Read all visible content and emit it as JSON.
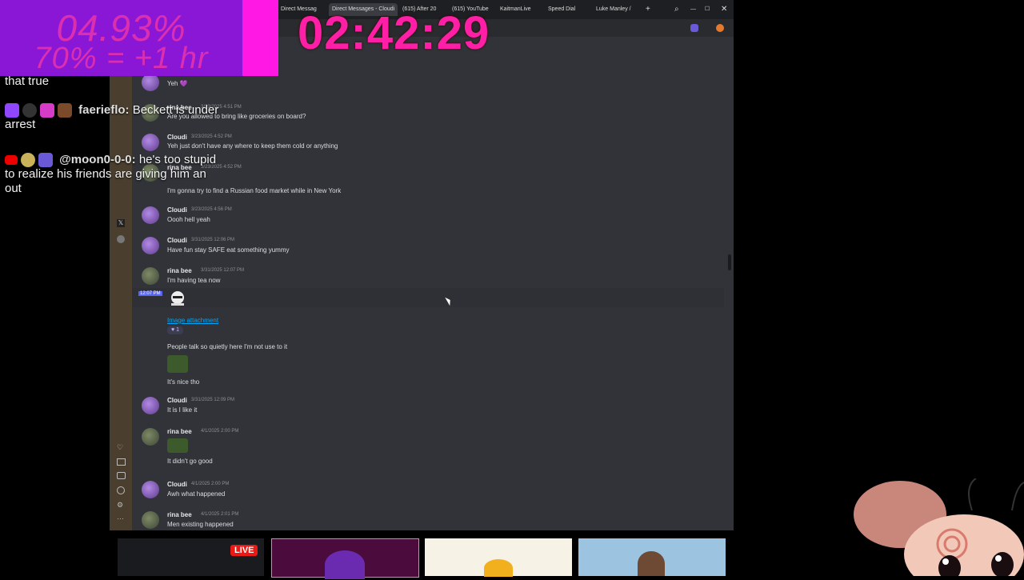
{
  "overlay": {
    "timer_percent": "04.93%",
    "timer_rule": "70% = +1 hr",
    "clock": "02:42:29",
    "live_label": "LIVE"
  },
  "chat": [
    {
      "user": "",
      "text": "that true"
    },
    {
      "user": "faerieflo:",
      "text": "Beckett is under arrest"
    },
    {
      "user": "@moon0-0-0:",
      "text": "he's too stupid to realize his friends are giving him an out"
    }
  ],
  "browser": {
    "tabs": [
      "Direct Messag",
      "Direct Messages - Cloudi",
      "(615) After 20",
      "(615) YouTube",
      "KaitmanLive",
      "Speed Dial",
      "Luke Manley /"
    ]
  },
  "messages": [
    {
      "author": "",
      "time": "",
      "lines": [
        "Yeh 💜"
      ],
      "avatar": "cloudi"
    },
    {
      "author": "rina bee",
      "time": "3/23/2025 4:51 PM",
      "lines": [
        "Are you allowed to bring like groceries on board?"
      ],
      "avatar": "rina"
    },
    {
      "author": "Cloudi",
      "time": "3/23/2025 4:52 PM",
      "lines": [
        "Yeh just don't have any where to keep them cold or anything"
      ],
      "avatar": "cloudi"
    },
    {
      "author": "rina bee",
      "time": "3/23/2025 4:52 PM",
      "lines": [
        "I'm gonna try to find a Russian food market while in New York"
      ],
      "avatar": "rina"
    },
    {
      "author": "Cloudi",
      "time": "3/23/2025 4:56 PM",
      "lines": [
        "Oooh hell yeah"
      ],
      "avatar": "cloudi"
    },
    {
      "author": "Cloudi",
      "time": "3/31/2025 12:06 PM",
      "lines": [
        "Have fun stay SAFE eat something yummy"
      ],
      "avatar": "cloudi"
    },
    {
      "author": "rina bee",
      "time": "3/31/2025 12:07 PM",
      "lines": [
        "I'm having tea now"
      ],
      "avatar": "rina"
    },
    {
      "author": "",
      "time": "12:07 PM",
      "lines": [],
      "avatar": ""
    },
    {
      "author": "",
      "time": "",
      "lines": [
        "Image attachment"
      ],
      "avatar": ""
    },
    {
      "author": "",
      "time": "",
      "lines": [
        "People talk so quietly here I'm not use to it"
      ],
      "avatar": ""
    },
    {
      "author": "",
      "time": "",
      "lines": [
        "It's nice tho"
      ],
      "avatar": ""
    },
    {
      "author": "Cloudi",
      "time": "3/31/2025 12:09 PM",
      "lines": [
        "It is I like it"
      ],
      "avatar": "cloudi"
    },
    {
      "author": "rina bee",
      "time": "4/1/2025 2:00 PM",
      "lines": [
        "It didn't go good"
      ],
      "avatar": "rina"
    },
    {
      "author": "Cloudi",
      "time": "4/1/2025 2:00 PM",
      "lines": [
        "Awh what happened"
      ],
      "avatar": "cloudi"
    },
    {
      "author": "rina bee",
      "time": "4/1/2025 2:01 PM",
      "lines": [
        "Men existing happened"
      ],
      "avatar": "rina"
    }
  ],
  "colors": {
    "overlay_purple": "#8a17d6",
    "overlay_pink": "#ff1fa6",
    "discord_bg": "#313338",
    "link": "#00a8fc"
  }
}
